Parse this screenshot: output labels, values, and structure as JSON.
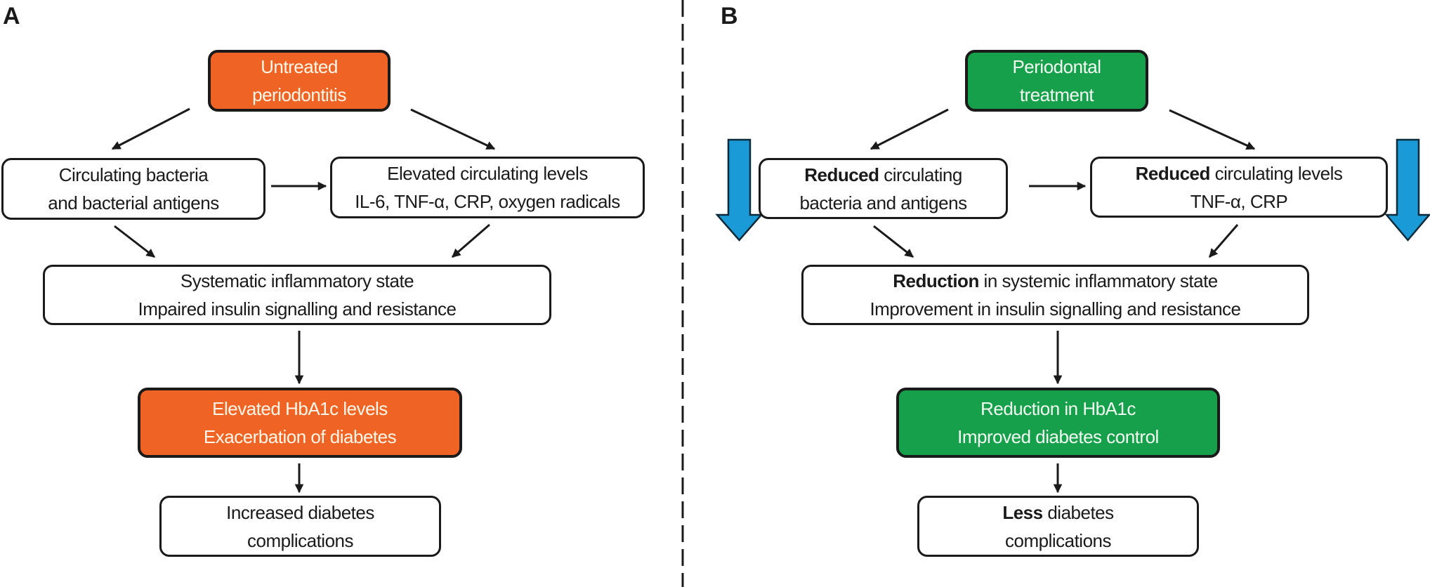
{
  "colors": {
    "untreated": "#ef6424",
    "treated": "#17a04c",
    "decrease_arrow": "#1a9ad6",
    "stroke": "#1a1a1a"
  },
  "panel_a": {
    "label": "A",
    "start": {
      "lines": [
        "Untreated",
        "periodontitis"
      ]
    },
    "left_node": {
      "lines": [
        "Circulating bacteria",
        "and bacterial antigens"
      ]
    },
    "right_node": {
      "lines": [
        "Elevated circulating levels",
        "IL-6, TNF-α, CRP, oxygen radicals"
      ]
    },
    "merge_node": {
      "lines": [
        "Systematic inflammatory state",
        "Impaired insulin signalling and resistance"
      ]
    },
    "outcome_node": {
      "lines": [
        "Elevated HbA1c levels",
        "Exacerbation of diabetes"
      ]
    },
    "final_node": {
      "lines": [
        "Increased diabetes",
        "complications"
      ]
    }
  },
  "panel_b": {
    "label": "B",
    "start": {
      "lines": [
        "Periodontal",
        "treatment"
      ]
    },
    "left_node": {
      "bold": "Reduced",
      "lines": [
        " circulating",
        "bacteria and antigens"
      ]
    },
    "right_node": {
      "bold": "Reduced",
      "lines": [
        " circulating levels",
        "TNF-α, CRP"
      ]
    },
    "merge_node": {
      "bold": "Reduction",
      "lines": [
        " in systemic inflammatory state",
        "Improvement in insulin signalling and resistance"
      ]
    },
    "outcome_node": {
      "lines": [
        "Reduction in HbA1c",
        "Improved diabetes control"
      ]
    },
    "final_node": {
      "bold": "Less",
      "lines": [
        " diabetes",
        "complications"
      ]
    },
    "decrease_indicators": [
      "left-decrease-arrow",
      "right-decrease-arrow"
    ]
  }
}
